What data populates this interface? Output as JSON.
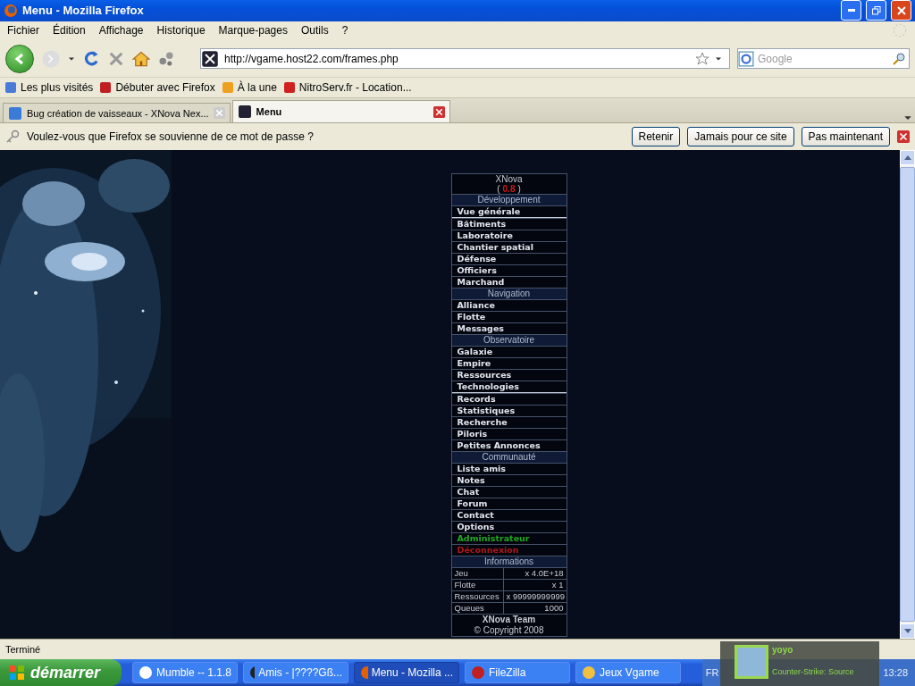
{
  "window": {
    "title": "Menu - Mozilla Firefox"
  },
  "menu_bar": [
    "Fichier",
    "Édition",
    "Affichage",
    "Historique",
    "Marque-pages",
    "Outils",
    "?"
  ],
  "address_bar": {
    "value": "http://vgame.host22.com/frames.php"
  },
  "search": {
    "placeholder": "Google"
  },
  "bookmarks": [
    "Les plus visités",
    "Débuter avec Firefox",
    "À la une",
    "NitroServ.fr - Location..."
  ],
  "tabs": [
    {
      "label": "Bug création de vaisseaux - XNova Nex...",
      "selected": false
    },
    {
      "label": "Menu",
      "selected": true
    }
  ],
  "password_bar": {
    "message": "Voulez-vous que Firefox se souvienne de ce mot de passe ?",
    "buttons": [
      "Retenir",
      "Jamais pour ce site",
      "Pas maintenant"
    ]
  },
  "game_menu": {
    "title": "XNova",
    "version_open": "(",
    "version": "0.8",
    "version_close": ")",
    "items": [
      {
        "kind": "header",
        "label": "Développement"
      },
      {
        "kind": "link",
        "label": "Vue générale"
      },
      {
        "kind": "divider"
      },
      {
        "kind": "link",
        "label": "Bâtiments"
      },
      {
        "kind": "link",
        "label": "Laboratoire"
      },
      {
        "kind": "link",
        "label": "Chantier spatial"
      },
      {
        "kind": "link",
        "label": "Défense"
      },
      {
        "kind": "link",
        "label": "Officiers"
      },
      {
        "kind": "link",
        "label": "Marchand"
      },
      {
        "kind": "header",
        "label": "Navigation"
      },
      {
        "kind": "link",
        "label": "Alliance"
      },
      {
        "kind": "link",
        "label": "Flotte"
      },
      {
        "kind": "link",
        "label": "Messages"
      },
      {
        "kind": "header",
        "label": "Observatoire"
      },
      {
        "kind": "link",
        "label": "Galaxie"
      },
      {
        "kind": "link",
        "label": "Empire"
      },
      {
        "kind": "link",
        "label": "Ressources"
      },
      {
        "kind": "link",
        "label": "Technologies"
      },
      {
        "kind": "divider"
      },
      {
        "kind": "link",
        "label": "Records"
      },
      {
        "kind": "link",
        "label": "Statistiques"
      },
      {
        "kind": "link",
        "label": "Recherche"
      },
      {
        "kind": "link",
        "label": "Piloris"
      },
      {
        "kind": "link",
        "label": "Petites Annonces"
      },
      {
        "kind": "header",
        "label": "Communauté"
      },
      {
        "kind": "link",
        "label": "Liste amis"
      },
      {
        "kind": "link",
        "label": "Notes"
      },
      {
        "kind": "link",
        "label": "Chat"
      },
      {
        "kind": "link",
        "label": "Forum"
      },
      {
        "kind": "link",
        "label": "Contact"
      },
      {
        "kind": "link",
        "label": "Options"
      },
      {
        "kind": "link",
        "label": "Administrateur",
        "color": "#22a822"
      },
      {
        "kind": "link",
        "label": "Déconnexion",
        "color": "#b01818"
      },
      {
        "kind": "header",
        "label": "Informations"
      }
    ],
    "info": [
      {
        "label": "Jeu",
        "value": "x 4.0E+18"
      },
      {
        "label": "Flotte",
        "value": "x 1"
      },
      {
        "label": "Ressources",
        "value": "x 99999999999"
      },
      {
        "label": "Queues",
        "value": "1000"
      }
    ],
    "team": "XNova Team",
    "copyright": "© Copyright 2008"
  },
  "status_bar": {
    "text": "Terminé"
  },
  "taskbar": {
    "start": "démarrer",
    "tasks": [
      {
        "label": "Mumble -- 1.1.8",
        "selected": false
      },
      {
        "label": "Amis - |????Gß...",
        "selected": false
      },
      {
        "label": "Menu - Mozilla ...",
        "selected": true
      },
      {
        "label": "FileZilla",
        "selected": false
      },
      {
        "label": "Jeux Vgame",
        "selected": false
      }
    ],
    "language": "FR",
    "clock": "13:28"
  },
  "toast": {
    "name": "yoyo",
    "game": "Counter-Strike: Source"
  }
}
